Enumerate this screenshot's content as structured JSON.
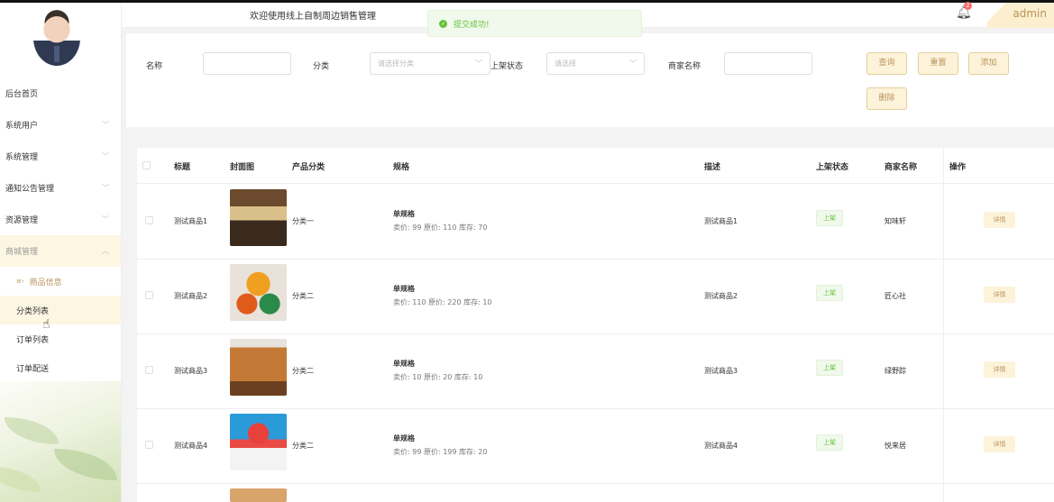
{
  "header": {
    "welcome": "欢迎使用线上自制周边销售管理",
    "notification_count": "2",
    "username": "admin"
  },
  "toast": {
    "message": "提交成功!"
  },
  "sidebar": {
    "items": [
      {
        "label": "后台首页",
        "chevron": false
      },
      {
        "label": "系统用户",
        "chevron": true
      },
      {
        "label": "系统管理",
        "chevron": true
      },
      {
        "label": "通知公告管理",
        "chevron": true
      },
      {
        "label": "资源管理",
        "chevron": true
      },
      {
        "label": "商城管理",
        "chevron": true,
        "open": true
      }
    ],
    "sub_items": [
      {
        "label": "商品信息",
        "active": true
      },
      {
        "label": "分类列表",
        "hover": true
      },
      {
        "label": "订单列表"
      },
      {
        "label": "订单配送"
      }
    ]
  },
  "search": {
    "name_label": "名称",
    "name_value": "",
    "category_label": "分类",
    "category_placeholder": "请选择分类",
    "status_label": "上架状态",
    "status_placeholder": "请选择",
    "merchant_label": "商家名称",
    "merchant_value": "",
    "query_button": "查询",
    "reset_button": "重置",
    "add_button": "添加",
    "delete_button": "删除"
  },
  "table": {
    "columns": [
      "标题",
      "封面图",
      "产品分类",
      "规格",
      "描述",
      "上架状态",
      "商家名称",
      "操作"
    ],
    "rows": [
      {
        "title": "测试商品1",
        "category": "分类一",
        "spec_name": "单规格",
        "spec_detail": "卖价: 99  原价: 110  库存: 70",
        "description": "测试商品1",
        "status": "上架",
        "merchant": "知味轩",
        "action": "详情"
      },
      {
        "title": "测试商品2",
        "category": "分类二",
        "spec_name": "单规格",
        "spec_detail": "卖价: 110  原价: 220  库存: 10",
        "description": "测试商品2",
        "status": "上架",
        "merchant": "匠心社",
        "action": "详情"
      },
      {
        "title": "测试商品3",
        "category": "分类二",
        "spec_name": "单规格",
        "spec_detail": "卖价: 10  原价: 20  库存: 10",
        "description": "测试商品3",
        "status": "上架",
        "merchant": "绿野踪",
        "action": "详情"
      },
      {
        "title": "测试商品4",
        "category": "分类二",
        "spec_name": "单规格",
        "spec_detail": "卖价: 99  原价: 199  库存: 20",
        "description": "测试商品4",
        "status": "上架",
        "merchant": "悦来居",
        "action": "详情"
      }
    ]
  },
  "colors": {
    "accent": "#b9935a",
    "accent_bg": "#fdf3da",
    "success": "#67c23a",
    "badge": "#f56c6c"
  }
}
